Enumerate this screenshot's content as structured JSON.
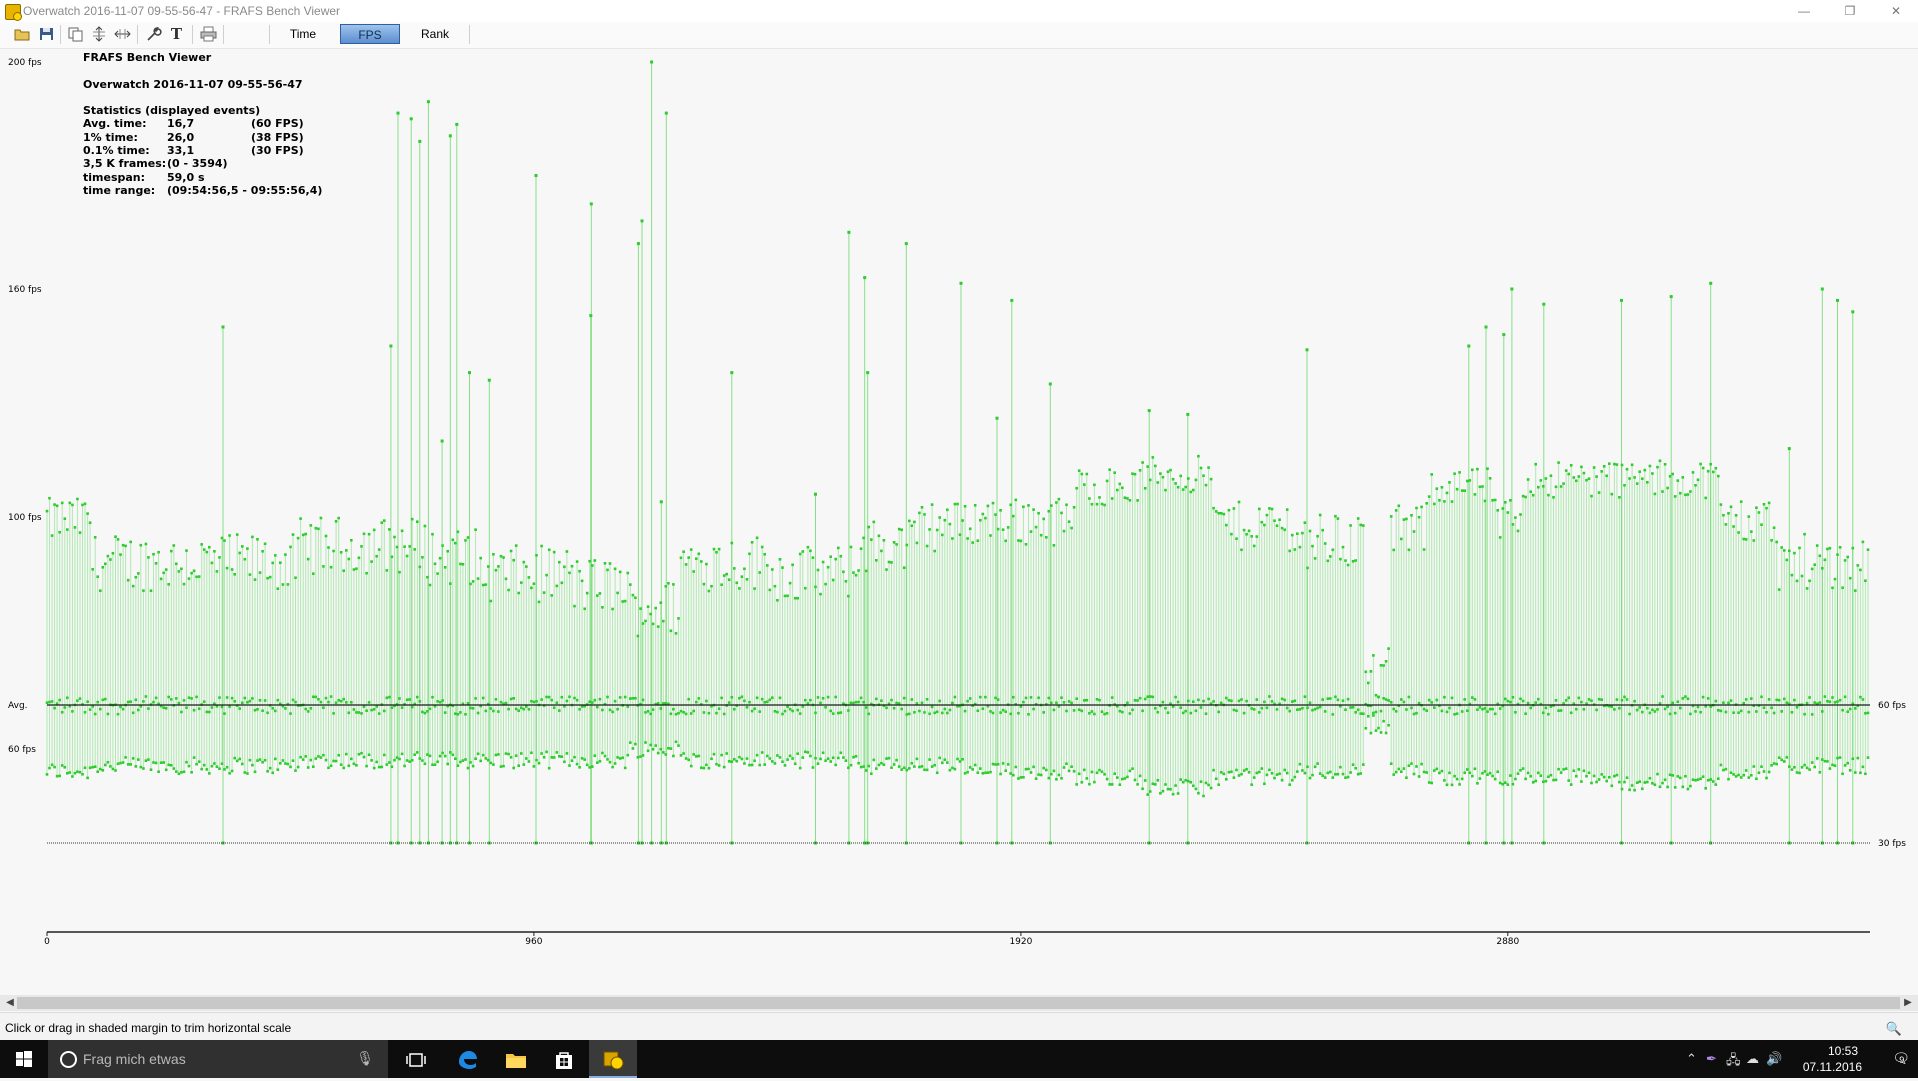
{
  "window": {
    "title": "Overwatch 2016-11-07 09-55-56-47 - FRAFS Bench Viewer",
    "minimize": "—",
    "restore": "❐",
    "close": "✕"
  },
  "toolbar": {
    "icons": [
      "open-folder-icon",
      "save-icon",
      "copy-icon",
      "fit-vertical-icon",
      "fit-horizontal-icon",
      "settings-wrench-icon",
      "text-icon",
      "print-icon"
    ],
    "tabs": [
      {
        "label": "Time",
        "active": false
      },
      {
        "label": "FPS",
        "active": true
      },
      {
        "label": "Rank",
        "active": false
      }
    ]
  },
  "stats": {
    "app_name": "FRAFS Bench Viewer",
    "session": "Overwatch 2016-11-07 09-55-56-47",
    "heading": "Statistics (displayed events)",
    "rows": [
      {
        "label": "Avg. time:",
        "value": "16,7",
        "extra": "(60 FPS)"
      },
      {
        "label": "1% time:",
        "value": "26,0",
        "extra": "(38 FPS)"
      },
      {
        "label": "0.1% time:",
        "value": "33,1",
        "extra": "(30 FPS)"
      },
      {
        "label": "3,5 K frames:",
        "value": "(0 - 3594)",
        "extra": ""
      },
      {
        "label": "timespan:",
        "value": "59,0 s",
        "extra": ""
      },
      {
        "label": "time range:",
        "value": "(09:54:56,5 - 09:55:56,4)",
        "extra": ""
      }
    ]
  },
  "chart_data": {
    "type": "scatter",
    "title": "",
    "xlabel": "",
    "ylabel": "",
    "xlim": [
      0,
      3594
    ],
    "ylim": [
      0,
      210
    ],
    "x_ticks": [
      "0",
      "960",
      "1920",
      "2880"
    ],
    "y_ticks_left": [
      {
        "label": "200 fps",
        "value": 200
      },
      {
        "label": "160 fps",
        "value": 160
      },
      {
        "label": "100 fps",
        "value": 100
      },
      {
        "label": "Avg.",
        "value": 67
      },
      {
        "label": "60 fps",
        "value": 60
      }
    ],
    "y_ticks_right": [
      {
        "label": "60 fps",
        "value": 67
      },
      {
        "label": "30 fps",
        "value": 43
      }
    ],
    "reference_lines": [
      {
        "name": "avg",
        "value": 67
      },
      {
        "name": "30fps",
        "value": 43
      }
    ],
    "color": "#2ecc2e",
    "bands": [
      [
        0,
        90,
        100,
        56
      ],
      [
        90,
        500,
        92,
        57
      ],
      [
        500,
        750,
        95,
        58
      ],
      [
        750,
        850,
        93,
        58
      ],
      [
        850,
        1040,
        90,
        58
      ],
      [
        1040,
        1150,
        88,
        58
      ],
      [
        1150,
        1250,
        84,
        60
      ],
      [
        1250,
        1430,
        92,
        58
      ],
      [
        1430,
        1600,
        90,
        58
      ],
      [
        1600,
        1720,
        95,
        57
      ],
      [
        1720,
        1810,
        99,
        57
      ],
      [
        1810,
        2030,
        100,
        56
      ],
      [
        2030,
        2160,
        108,
        55
      ],
      [
        2160,
        2300,
        111,
        53
      ],
      [
        2300,
        2460,
        99,
        55
      ],
      [
        2460,
        2600,
        96,
        56
      ],
      [
        2600,
        2650,
        72,
        64
      ],
      [
        2650,
        2720,
        98,
        56
      ],
      [
        2720,
        2850,
        108,
        55
      ],
      [
        2850,
        2910,
        100,
        55
      ],
      [
        2910,
        3080,
        110,
        55
      ],
      [
        3080,
        3300,
        110,
        54
      ],
      [
        3300,
        3410,
        100,
        56
      ],
      [
        3410,
        3594,
        92,
        57
      ]
    ],
    "spikes": [
      [
        347,
        150
      ],
      [
        678,
        145
      ],
      [
        692,
        191
      ],
      [
        718,
        190
      ],
      [
        735,
        186
      ],
      [
        752,
        193
      ],
      [
        779,
        120
      ],
      [
        795,
        187
      ],
      [
        808,
        189
      ],
      [
        833,
        138
      ],
      [
        872,
        136
      ],
      [
        964,
        180
      ],
      [
        1072,
        153
      ],
      [
        1073,
        175
      ],
      [
        1166,
        168
      ],
      [
        1173,
        172
      ],
      [
        1192,
        200
      ],
      [
        1211,
        104
      ],
      [
        1221,
        191
      ],
      [
        1350,
        138
      ],
      [
        1515,
        106
      ],
      [
        1581,
        170
      ],
      [
        1612,
        162
      ],
      [
        1618,
        138
      ],
      [
        1694,
        168
      ],
      [
        1802,
        161
      ],
      [
        1873,
        126
      ],
      [
        1902,
        157
      ],
      [
        1978,
        135
      ],
      [
        2173,
        128
      ],
      [
        2249,
        127
      ],
      [
        2484,
        144
      ],
      [
        2803,
        145
      ],
      [
        2837,
        150
      ],
      [
        2872,
        148
      ],
      [
        2888,
        160
      ],
      [
        2951,
        156
      ],
      [
        3104,
        157
      ],
      [
        3202,
        158
      ],
      [
        3280,
        161
      ],
      [
        3435,
        118
      ],
      [
        3500,
        160
      ],
      [
        3530,
        157
      ],
      [
        3560,
        154
      ]
    ]
  },
  "statusbar": {
    "text": "Click or drag in shaded margin to trim horizontal scale"
  },
  "taskbar": {
    "search_placeholder": "Frag mich etwas",
    "time": "10:53",
    "date": "07.11.2016",
    "notifications": "9"
  }
}
